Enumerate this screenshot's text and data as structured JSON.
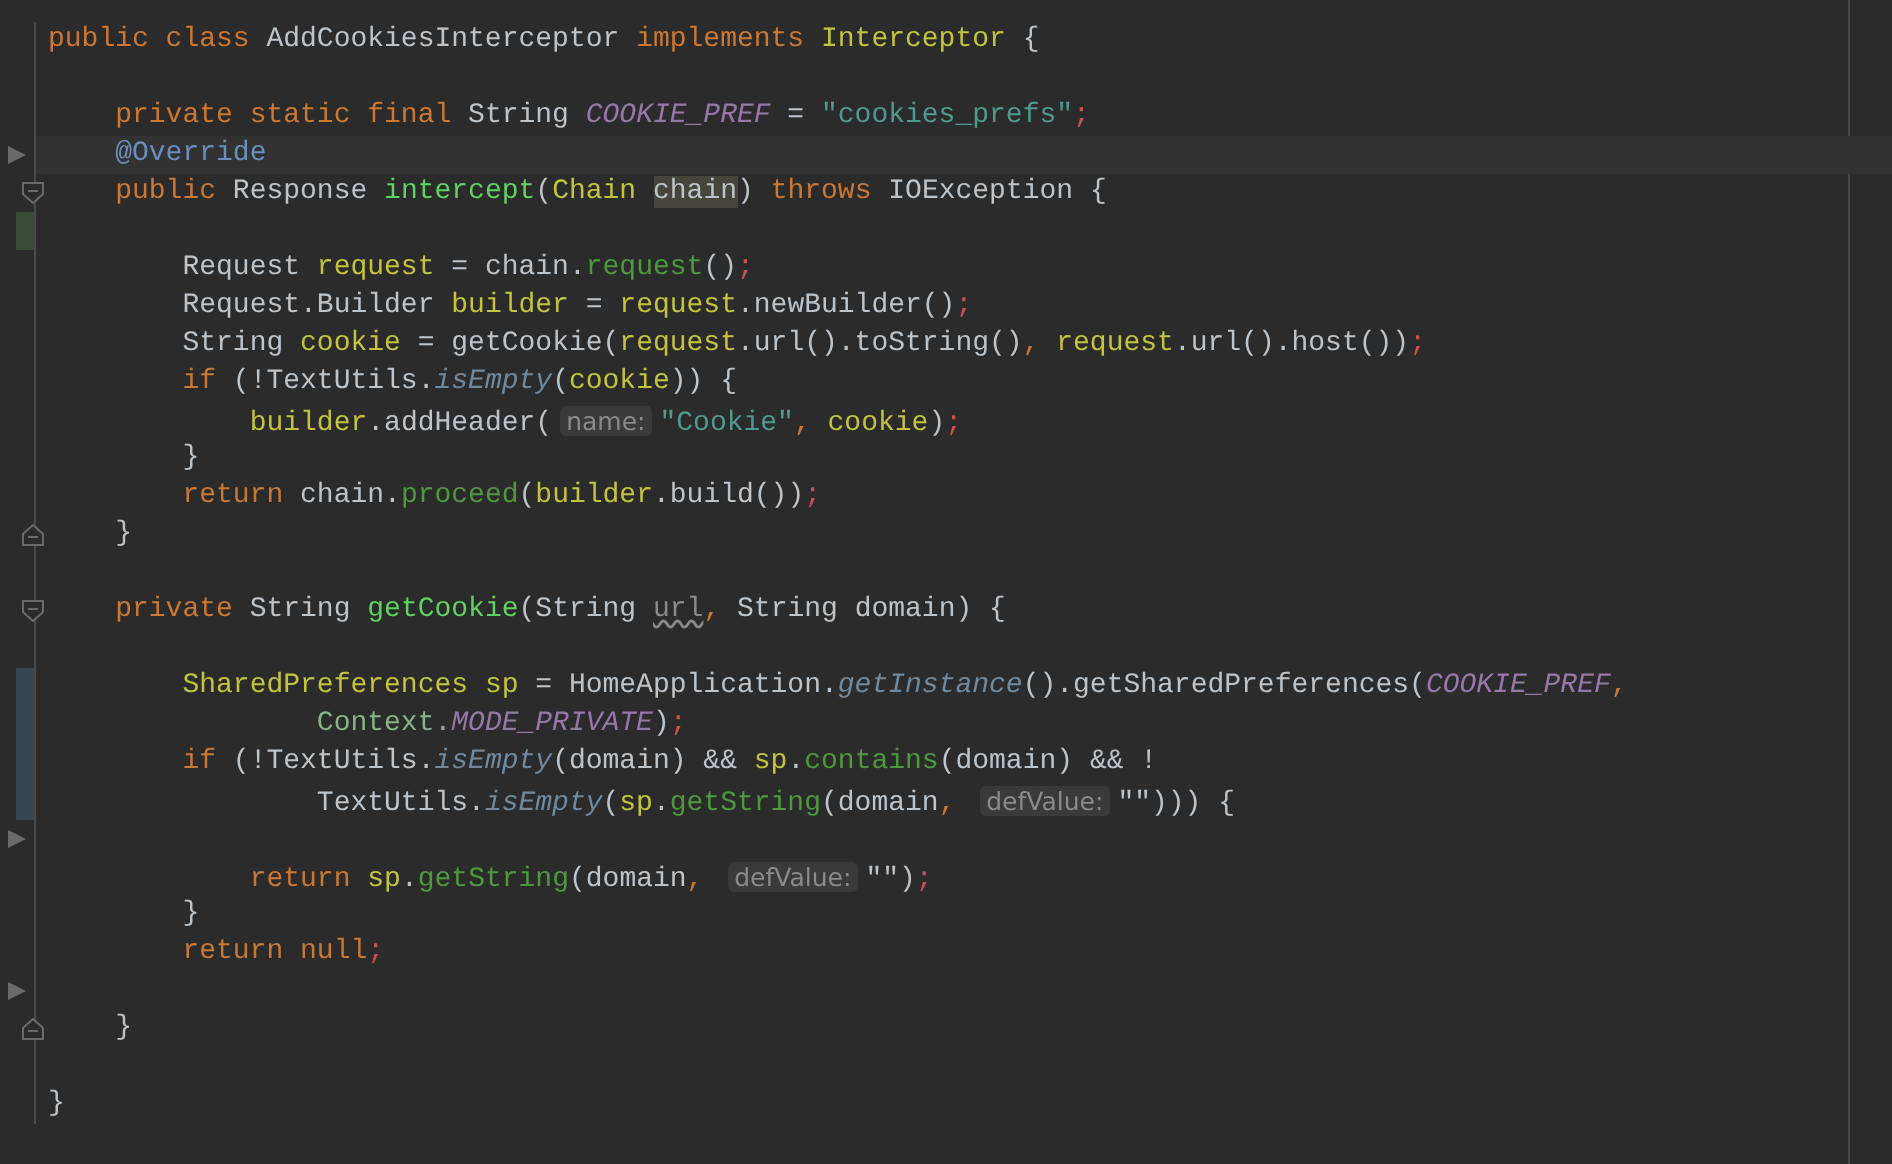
{
  "editor": {
    "lines": [
      {
        "kind": "code",
        "current": false,
        "arrow": false,
        "fold_start": false,
        "fold_end": false,
        "added": false,
        "modified": false,
        "tokens": [
          {
            "kind": "kw",
            "text": "public class "
          },
          {
            "kind": "plain",
            "text": "AddCookiesInterceptor "
          },
          {
            "kind": "kw",
            "text": "implements "
          },
          {
            "kind": "cls",
            "text": "Interceptor "
          },
          {
            "kind": "plain",
            "text": "{"
          }
        ]
      },
      {
        "kind": "blank",
        "current": false,
        "arrow": false,
        "fold_start": false,
        "fold_end": false,
        "added": false,
        "modified": false
      },
      {
        "kind": "code",
        "current": false,
        "arrow": false,
        "fold_start": false,
        "fold_end": false,
        "added": false,
        "modified": false,
        "tokens": [
          {
            "kind": "kw",
            "text": "    private static final "
          },
          {
            "kind": "plain",
            "text": "String "
          },
          {
            "kind": "field",
            "text": "COOKIE_PREF"
          },
          {
            "kind": "plain",
            "text": " = "
          },
          {
            "kind": "str",
            "text": "\"cookies_prefs\""
          },
          {
            "kind": "semi",
            "text": ";"
          }
        ]
      },
      {
        "kind": "code",
        "current": true,
        "arrow": true,
        "fold_start": false,
        "fold_end": false,
        "added": false,
        "modified": false,
        "tokens": [
          {
            "kind": "ann",
            "text": "    @Override"
          }
        ]
      },
      {
        "kind": "code",
        "current": false,
        "arrow": false,
        "fold_start": true,
        "fold_end": false,
        "added": false,
        "modified": false,
        "tokens": [
          {
            "kind": "kw",
            "text": "    public "
          },
          {
            "kind": "plain",
            "text": "Response "
          },
          {
            "kind": "decl",
            "text": "intercept"
          },
          {
            "kind": "plain",
            "text": "("
          },
          {
            "kind": "cls",
            "text": "Chain "
          },
          {
            "kind": "param",
            "text": "chain"
          },
          {
            "kind": "plain",
            "text": ") "
          },
          {
            "kind": "kw",
            "text": "throws "
          },
          {
            "kind": "plain",
            "text": "IOException {"
          }
        ]
      },
      {
        "kind": "blank",
        "current": false,
        "arrow": false,
        "fold_start": false,
        "fold_end": false,
        "added": true,
        "modified": false
      },
      {
        "kind": "code",
        "current": false,
        "arrow": false,
        "fold_start": false,
        "fold_end": false,
        "added": false,
        "modified": false,
        "tokens": [
          {
            "kind": "plain",
            "text": "        Request "
          },
          {
            "kind": "var",
            "text": "request"
          },
          {
            "kind": "plain",
            "text": " = chain."
          },
          {
            "kind": "call",
            "text": "request"
          },
          {
            "kind": "plain",
            "text": "()"
          },
          {
            "kind": "semi",
            "text": ";"
          }
        ]
      },
      {
        "kind": "code",
        "current": false,
        "arrow": false,
        "fold_start": false,
        "fold_end": false,
        "added": false,
        "modified": false,
        "tokens": [
          {
            "kind": "plain",
            "text": "        Request.Builder "
          },
          {
            "kind": "var",
            "text": "builder"
          },
          {
            "kind": "plain",
            "text": " = "
          },
          {
            "kind": "var",
            "text": "request"
          },
          {
            "kind": "plain",
            "text": ".newBuilder()"
          },
          {
            "kind": "semi",
            "text": ";"
          }
        ]
      },
      {
        "kind": "code",
        "current": false,
        "arrow": false,
        "fold_start": false,
        "fold_end": false,
        "added": false,
        "modified": false,
        "tokens": [
          {
            "kind": "plain",
            "text": "        String "
          },
          {
            "kind": "var",
            "text": "cookie"
          },
          {
            "kind": "plain",
            "text": " = getCookie("
          },
          {
            "kind": "var",
            "text": "request"
          },
          {
            "kind": "plain",
            "text": ".url().toString()"
          },
          {
            "kind": "kw",
            "text": ", "
          },
          {
            "kind": "var",
            "text": "request"
          },
          {
            "kind": "plain",
            "text": ".url().host())"
          },
          {
            "kind": "semi",
            "text": ";"
          }
        ]
      },
      {
        "kind": "code",
        "current": false,
        "arrow": false,
        "fold_start": false,
        "fold_end": false,
        "added": false,
        "modified": false,
        "tokens": [
          {
            "kind": "kw",
            "text": "        if "
          },
          {
            "kind": "plain",
            "text": "(!TextUtils."
          },
          {
            "kind": "static",
            "text": "isEmpty"
          },
          {
            "kind": "plain",
            "text": "("
          },
          {
            "kind": "var",
            "text": "cookie"
          },
          {
            "kind": "plain",
            "text": ")) {"
          }
        ]
      },
      {
        "kind": "code",
        "current": false,
        "arrow": false,
        "fold_start": false,
        "fold_end": false,
        "added": false,
        "modified": false,
        "tokens": [
          {
            "kind": "var",
            "text": "            builder"
          },
          {
            "kind": "plain",
            "text": ".addHeader("
          },
          {
            "kind": "hint",
            "text": "name:"
          },
          {
            "kind": "str",
            "text": "\"Cookie\""
          },
          {
            "kind": "kw",
            "text": ", "
          },
          {
            "kind": "var",
            "text": "cookie"
          },
          {
            "kind": "plain",
            "text": ")"
          },
          {
            "kind": "semi",
            "text": ";"
          }
        ]
      },
      {
        "kind": "code",
        "current": false,
        "arrow": false,
        "fold_start": false,
        "fold_end": false,
        "added": false,
        "modified": false,
        "tokens": [
          {
            "kind": "plain",
            "text": "        }"
          }
        ]
      },
      {
        "kind": "code",
        "current": false,
        "arrow": false,
        "fold_start": false,
        "fold_end": false,
        "added": false,
        "modified": false,
        "tokens": [
          {
            "kind": "kw",
            "text": "        return "
          },
          {
            "kind": "plain",
            "text": "chain."
          },
          {
            "kind": "call",
            "text": "proceed"
          },
          {
            "kind": "plain",
            "text": "("
          },
          {
            "kind": "var",
            "text": "builder"
          },
          {
            "kind": "plain",
            "text": ".build())"
          },
          {
            "kind": "semi",
            "text": ";"
          }
        ]
      },
      {
        "kind": "code",
        "current": false,
        "arrow": false,
        "fold_start": false,
        "fold_end": true,
        "added": false,
        "modified": false,
        "tokens": [
          {
            "kind": "plain",
            "text": "    }"
          }
        ]
      },
      {
        "kind": "blank",
        "current": false,
        "arrow": false,
        "fold_start": false,
        "fold_end": false,
        "added": false,
        "modified": false
      },
      {
        "kind": "code",
        "current": false,
        "arrow": false,
        "fold_start": true,
        "fold_end": false,
        "added": false,
        "modified": false,
        "tokens": [
          {
            "kind": "kw",
            "text": "    private "
          },
          {
            "kind": "plain",
            "text": "String "
          },
          {
            "kind": "decl",
            "text": "getCookie"
          },
          {
            "kind": "plain",
            "text": "(String "
          },
          {
            "kind": "unused",
            "text": "url"
          },
          {
            "kind": "kw",
            "text": ", "
          },
          {
            "kind": "plain",
            "text": "String domain) {"
          }
        ]
      },
      {
        "kind": "blank",
        "current": false,
        "arrow": false,
        "fold_start": false,
        "fold_end": false,
        "added": false,
        "modified": false
      },
      {
        "kind": "code",
        "current": false,
        "arrow": false,
        "fold_start": false,
        "fold_end": false,
        "added": false,
        "modified": true,
        "tokens": [
          {
            "kind": "cls",
            "text": "        SharedPreferences "
          },
          {
            "kind": "var",
            "text": "sp"
          },
          {
            "kind": "plain",
            "text": " = HomeApplication."
          },
          {
            "kind": "static",
            "text": "getInstance"
          },
          {
            "kind": "plain",
            "text": "().getSharedPreferences("
          },
          {
            "kind": "field",
            "text": "COOKIE_PREF"
          },
          {
            "kind": "kw",
            "text": ","
          }
        ]
      },
      {
        "kind": "code",
        "current": false,
        "arrow": false,
        "fold_start": false,
        "fold_end": false,
        "added": false,
        "modified": true,
        "tokens": [
          {
            "kind": "ctx",
            "text": "                Context."
          },
          {
            "kind": "field",
            "text": "MODE_PRIVATE"
          },
          {
            "kind": "plain",
            "text": ")"
          },
          {
            "kind": "semi",
            "text": ";"
          }
        ]
      },
      {
        "kind": "code",
        "current": false,
        "arrow": false,
        "fold_start": false,
        "fold_end": false,
        "added": false,
        "modified": true,
        "tokens": [
          {
            "kind": "kw",
            "text": "        if "
          },
          {
            "kind": "plain",
            "text": "(!TextUtils."
          },
          {
            "kind": "static",
            "text": "isEmpty"
          },
          {
            "kind": "plain",
            "text": "(domain) && "
          },
          {
            "kind": "var",
            "text": "sp"
          },
          {
            "kind": "plain",
            "text": "."
          },
          {
            "kind": "call",
            "text": "contains"
          },
          {
            "kind": "plain",
            "text": "(domain) && !"
          }
        ]
      },
      {
        "kind": "code",
        "current": false,
        "arrow": false,
        "fold_start": false,
        "fold_end": false,
        "added": false,
        "modified": true,
        "tokens": [
          {
            "kind": "plain",
            "text": "                TextUtils."
          },
          {
            "kind": "static",
            "text": "isEmpty"
          },
          {
            "kind": "plain",
            "text": "("
          },
          {
            "kind": "var",
            "text": "sp"
          },
          {
            "kind": "plain",
            "text": "."
          },
          {
            "kind": "call",
            "text": "getString"
          },
          {
            "kind": "plain",
            "text": "(domain"
          },
          {
            "kind": "kw",
            "text": ", "
          },
          {
            "kind": "hint",
            "text": "defValue:"
          },
          {
            "kind": "plain",
            "text": "\"\"))) {"
          }
        ]
      },
      {
        "kind": "blank",
        "current": false,
        "arrow": true,
        "fold_start": false,
        "fold_end": false,
        "added": false,
        "modified": false
      },
      {
        "kind": "code",
        "current": false,
        "arrow": false,
        "fold_start": false,
        "fold_end": false,
        "added": false,
        "modified": false,
        "tokens": [
          {
            "kind": "kw",
            "text": "            return "
          },
          {
            "kind": "var",
            "text": "sp"
          },
          {
            "kind": "plain",
            "text": "."
          },
          {
            "kind": "call",
            "text": "getString"
          },
          {
            "kind": "plain",
            "text": "(domain"
          },
          {
            "kind": "kw",
            "text": ", "
          },
          {
            "kind": "hint",
            "text": "defValue:"
          },
          {
            "kind": "plain",
            "text": "\"\")"
          },
          {
            "kind": "semi",
            "text": ";"
          }
        ]
      },
      {
        "kind": "code",
        "current": false,
        "arrow": false,
        "fold_start": false,
        "fold_end": false,
        "added": false,
        "modified": false,
        "tokens": [
          {
            "kind": "plain",
            "text": "        }"
          }
        ]
      },
      {
        "kind": "code",
        "current": false,
        "arrow": false,
        "fold_start": false,
        "fold_end": false,
        "added": false,
        "modified": false,
        "tokens": [
          {
            "kind": "kw",
            "text": "        return null"
          },
          {
            "kind": "semi",
            "text": ";"
          }
        ]
      },
      {
        "kind": "blank",
        "current": false,
        "arrow": true,
        "fold_start": false,
        "fold_end": false,
        "added": false,
        "modified": false
      },
      {
        "kind": "code",
        "current": false,
        "arrow": false,
        "fold_start": false,
        "fold_end": true,
        "added": false,
        "modified": false,
        "tokens": [
          {
            "kind": "plain",
            "text": "    }"
          }
        ]
      },
      {
        "kind": "blank",
        "current": false,
        "arrow": false,
        "fold_start": false,
        "fold_end": false,
        "added": false,
        "modified": false
      },
      {
        "kind": "code",
        "current": false,
        "arrow": false,
        "fold_start": false,
        "fold_end": false,
        "added": false,
        "modified": false,
        "tokens": [
          {
            "kind": "plain",
            "text": "}"
          }
        ]
      }
    ]
  }
}
